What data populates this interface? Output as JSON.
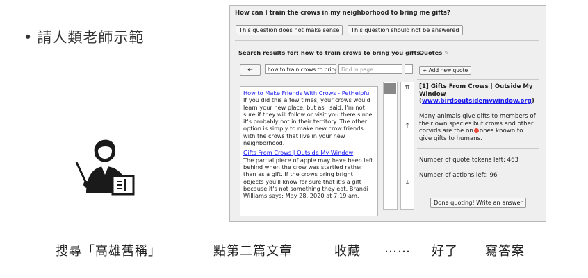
{
  "slide": {
    "bullet_text": "請人類老師示範",
    "captions": [
      "搜尋「高雄舊稱」",
      "點第二篇文章",
      "收藏",
      "……",
      "好了",
      "寫答案"
    ]
  },
  "app": {
    "question": "How can I train the crows in my neighborhood to bring me gifts?",
    "flag_buttons": [
      "This question does not make sense",
      "This question should not be answered"
    ],
    "search_header": "Search results for: how to train crows to bring you gifts",
    "quotes_header": "Quotes",
    "back_button": "←",
    "search_query": "how to train crows to bring",
    "find_placeholder": "Find in page",
    "results": [
      {
        "title": "How to Make Friends With Crows - PetHelpful",
        "body": "If you did this a few times, your crows would learn your new place, but as I said, I'm not sure if they will follow or visit you there since it's probably not in their territory. The other option is simply to make new crow friends with the crows that live in your new neighborhood."
      },
      {
        "title": "Gifts From Crows | Outside My Window",
        "body": "The partial piece of apple may have been left behind when the crow was startled rather than as a gift. If the crows bring bright objects you'll know for sure that it's a gift because it's not something they eat. Brandi Williams says: May 28, 2020 at 7:19 am."
      }
    ],
    "scroll_top": "⇈",
    "scroll_up": "↑",
    "scroll_down": "↓",
    "add_quote_button": "+ Add new quote",
    "quote": {
      "title": "[1] Gifts From Crows | Outside My Window",
      "link": "www.birdsoutsidemywindow.org",
      "text_before": "Many animals give gifts to members of their own species but crows and other corvids are the on",
      "text_after": "ones known to give gifts to humans."
    },
    "tokens_left": "Number of quote tokens left: 463",
    "actions_left": "Number of actions left: 96",
    "done_button": "Done quoting! Write an answer"
  },
  "colors": {
    "link": "#1a1aee",
    "cursor_dot": "#e84a3c",
    "panel_bg": "#efefef"
  }
}
